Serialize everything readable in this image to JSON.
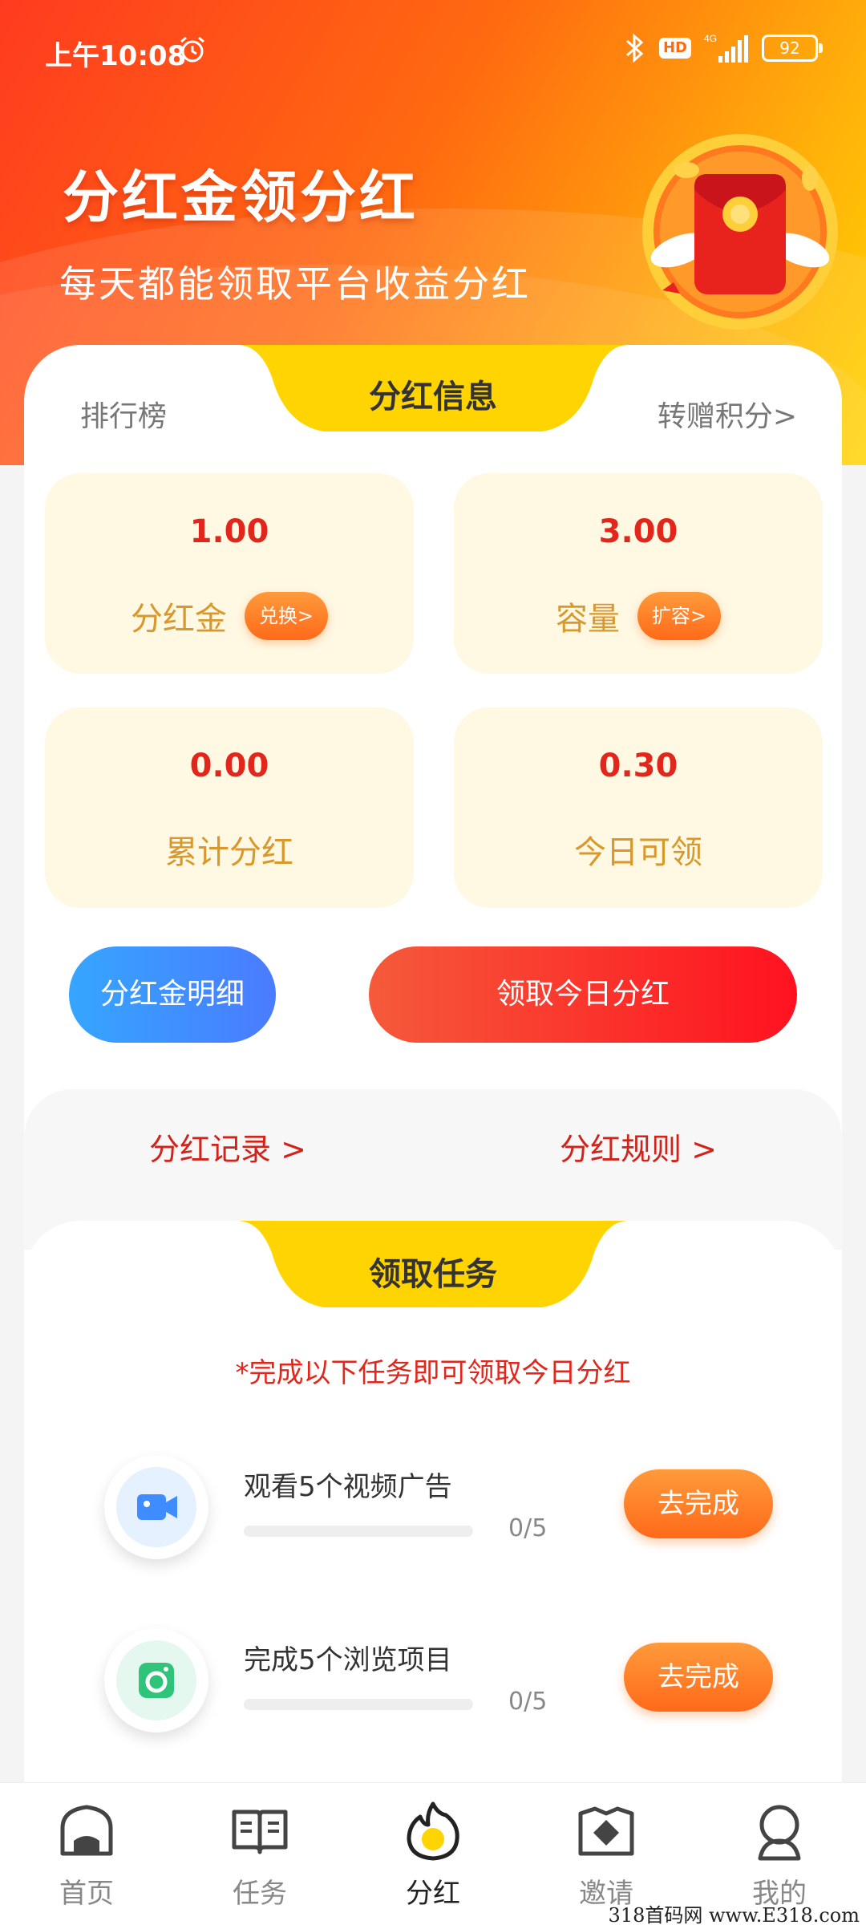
{
  "status_bar": {
    "time": "上午10:08",
    "network": "4G",
    "hd_label": "HD",
    "battery": "92"
  },
  "hero": {
    "title": "分红金领分红",
    "subtitle": "每天都能领取平台收益分红"
  },
  "info_tabs": {
    "left": "排行榜",
    "active": "分红信息",
    "right": "转赠积分>"
  },
  "stats": [
    {
      "value": "1.00",
      "label": "分红金",
      "chip": "兑换>"
    },
    {
      "value": "3.00",
      "label": "容量",
      "chip": "扩容>"
    },
    {
      "value": "0.00",
      "label": "累计分红"
    },
    {
      "value": "0.30",
      "label": "今日可领"
    }
  ],
  "actions": {
    "detail": "分红金明细",
    "claim": "领取今日分红"
  },
  "links": {
    "records": "分红记录  >",
    "rules": "分红规则  >"
  },
  "tasks": {
    "header": "领取任务",
    "notice": "*完成以下任务即可领取今日分红",
    "items": [
      {
        "title": "观看5个视频广告",
        "progress": "0/5",
        "done": 0,
        "total": 5,
        "button": "去完成",
        "icon": "video-camera-icon"
      },
      {
        "title": "完成5个浏览项目",
        "progress": "0/5",
        "done": 0,
        "total": 5,
        "button": "去完成",
        "icon": "camera-icon"
      }
    ]
  },
  "tabbar": [
    {
      "label": "首页",
      "icon": "home-icon"
    },
    {
      "label": "任务",
      "icon": "book-icon"
    },
    {
      "label": "分红",
      "icon": "flame-icon",
      "active": true
    },
    {
      "label": "邀请",
      "icon": "invite-envelope-icon"
    },
    {
      "label": "我的",
      "icon": "profile-icon"
    }
  ],
  "watermark": "318首码网  www.E318.com",
  "colors": {
    "accent_red": "#e2261c",
    "accent_orange": "#ff6a1a",
    "accent_yellow": "#ffd400",
    "label_gold": "#d9982c",
    "blue": "#3f8cff"
  }
}
